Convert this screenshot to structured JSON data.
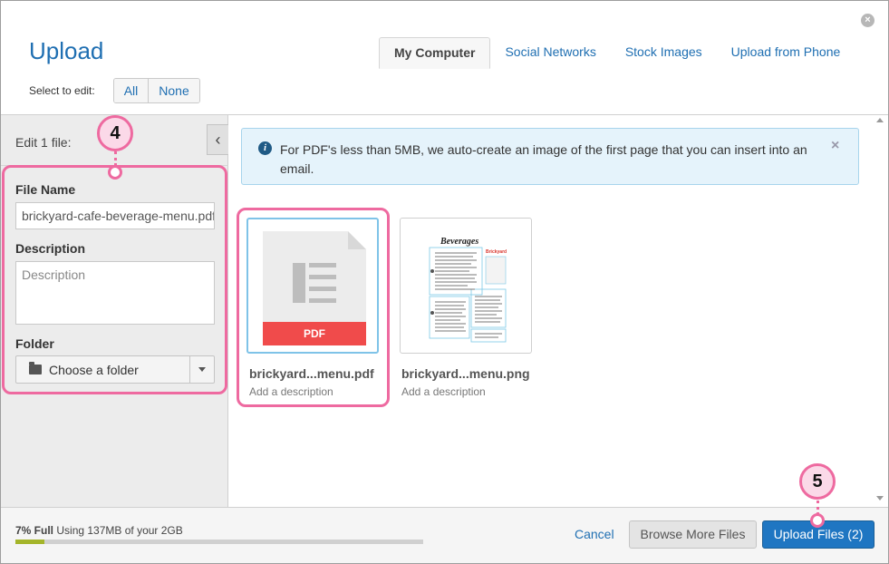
{
  "header": {
    "title": "Upload",
    "tabs": [
      {
        "label": "My Computer",
        "active": true
      },
      {
        "label": "Social Networks"
      },
      {
        "label": "Stock Images"
      },
      {
        "label": "Upload from Phone"
      }
    ],
    "select_label": "Select to edit:",
    "select_all": "All",
    "select_none": "None"
  },
  "left_panel": {
    "edit_label": "Edit 1 file:",
    "collapse_glyph": "‹",
    "file_name_label": "File Name",
    "file_name_value": "brickyard-cafe-beverage-menu.pdf",
    "description_label": "Description",
    "description_placeholder": "Description",
    "folder_label": "Folder",
    "folder_value": "Choose a folder"
  },
  "info": {
    "icon": "i",
    "text": "For PDF's less than 5MB, we auto-create an image of the first page that you can insert into an email.",
    "close": "×"
  },
  "files": [
    {
      "name": "brickyard...menu.pdf",
      "desc": "Add a description",
      "badge": "PDF"
    },
    {
      "name": "brickyard...menu.png",
      "desc": "Add a description"
    }
  ],
  "callouts": [
    {
      "label": "4"
    },
    {
      "label": "5"
    }
  ],
  "footer": {
    "storage_full": "7% Full",
    "storage_text": "Using 137MB of your 2GB",
    "storage_percent": 7,
    "cancel": "Cancel",
    "browse": "Browse More Files",
    "upload": "Upload Files (2)"
  },
  "colors": {
    "accent": "#1f6fb2",
    "callout": "#ee6aa0",
    "pdf_band": "#f04b4b",
    "storage_fill": "#a4b52a"
  },
  "icons": {
    "close": "close-circle-icon",
    "info": "info-circle-icon",
    "folder": "folder-icon",
    "chevron": "chevron-left-icon",
    "dropdown": "caret-down-icon"
  }
}
